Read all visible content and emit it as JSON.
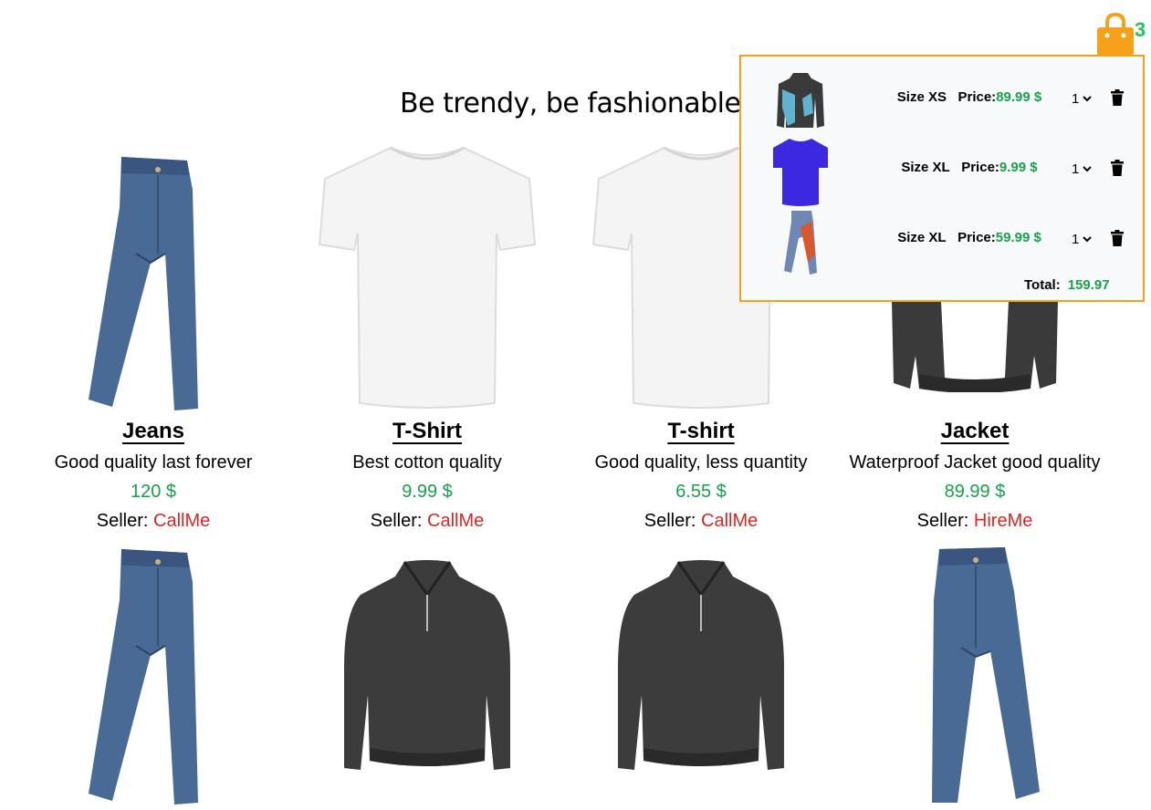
{
  "heading": "Be trendy, be fashionable!",
  "cart": {
    "count": "3",
    "icon": "shopping-bag-icon",
    "accent": "#f7a11a",
    "items": [
      {
        "size_label": "Size XS",
        "price_label": "Price:",
        "price_value": "89.99 $",
        "qty": "1",
        "thumb": "jacket"
      },
      {
        "size_label": "Size XL",
        "price_label": "Price:",
        "price_value": "9.99 $",
        "qty": "1",
        "thumb": "tshirt"
      },
      {
        "size_label": "Size XL",
        "price_label": "Price:",
        "price_value": "59.99 $",
        "qty": "1",
        "thumb": "jeans"
      }
    ],
    "total_label": "Total:",
    "total_value": "159.97"
  },
  "products": [
    {
      "name": "Jeans",
      "description": "Good quality last forever",
      "price": "120 $",
      "seller_label": "Seller:",
      "seller": "CallMe",
      "image": "jeans"
    },
    {
      "name": "T-Shirt",
      "description": "Best cotton quality",
      "price": "9.99 $",
      "seller_label": "Seller:",
      "seller": "CallMe",
      "image": "tshirt"
    },
    {
      "name": "T-shirt",
      "description": "Good quality, less quantity",
      "price": "6.55 $",
      "seller_label": "Seller:",
      "seller": "CallMe",
      "image": "tshirt"
    },
    {
      "name": "Jacket",
      "description": "Waterproof Jacket good quality",
      "price": "89.99 $",
      "seller_label": "Seller:",
      "seller": "HireMe",
      "image": "jacket"
    },
    {
      "image": "jeans"
    },
    {
      "image": "jacket"
    },
    {
      "image": "jacket"
    },
    {
      "image": "jeans"
    }
  ]
}
